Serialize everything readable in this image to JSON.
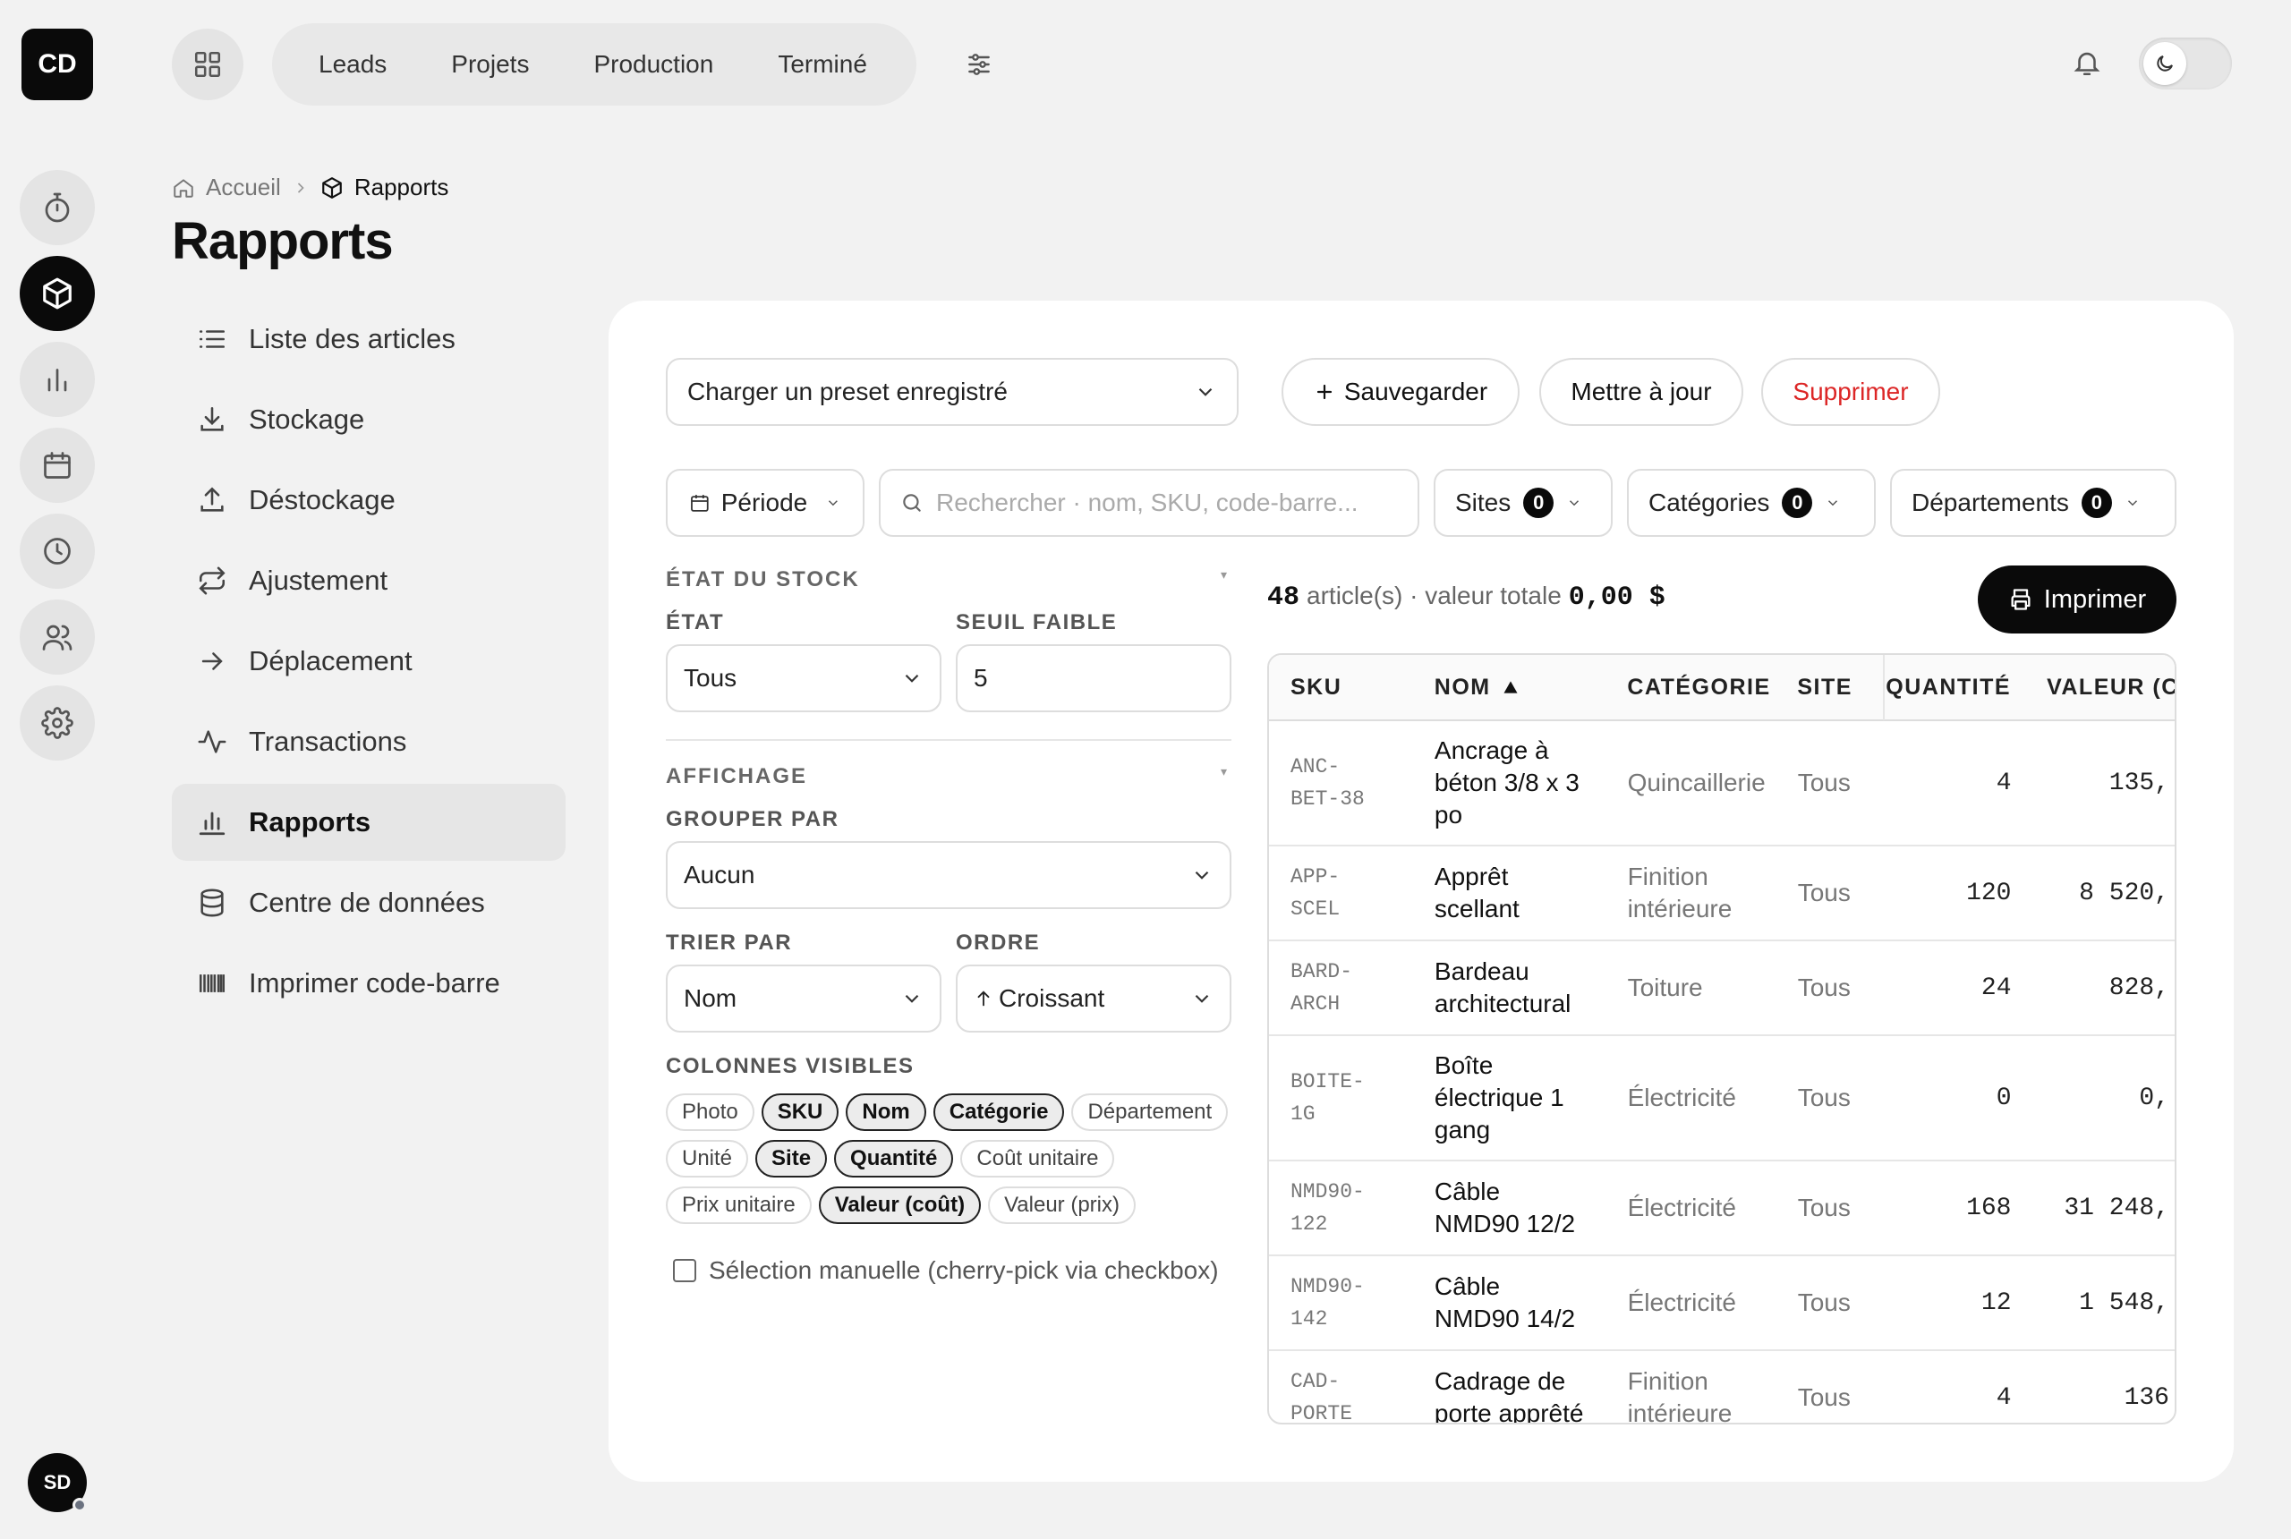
{
  "user": {
    "initials": "CD",
    "footer_initials": "SD"
  },
  "topnav": {
    "tabs": [
      "Leads",
      "Projets",
      "Production",
      "Terminé"
    ]
  },
  "breadcrumb": {
    "home": "Accueil",
    "current": "Rapports"
  },
  "page": {
    "title": "Rapports"
  },
  "sidebar": {
    "items": [
      {
        "label": "Liste des articles",
        "icon": "list-icon"
      },
      {
        "label": "Stockage",
        "icon": "download-icon"
      },
      {
        "label": "Déstockage",
        "icon": "upload-icon"
      },
      {
        "label": "Ajustement",
        "icon": "repeat-icon"
      },
      {
        "label": "Déplacement",
        "icon": "arrow-right-icon"
      },
      {
        "label": "Transactions",
        "icon": "activity-icon"
      },
      {
        "label": "Rapports",
        "icon": "bar-chart-icon",
        "active": true
      },
      {
        "label": "Centre de données",
        "icon": "database-icon"
      },
      {
        "label": "Imprimer code-barre",
        "icon": "barcode-icon"
      }
    ]
  },
  "toolbar": {
    "preset_placeholder": "Charger un preset enregistré",
    "save": "Sauvegarder",
    "update": "Mettre à jour",
    "delete": "Supprimer",
    "delete_color": "#dc2626"
  },
  "filters": {
    "period": "Période",
    "search_placeholder": "Rechercher · nom, SKU, code-barre...",
    "sites": {
      "label": "Sites",
      "count": "0"
    },
    "categories": {
      "label": "Catégories",
      "count": "0"
    },
    "departments": {
      "label": "Départements",
      "count": "0"
    }
  },
  "stock_state": {
    "section": "ÉTAT DU STOCK",
    "state_label": "ÉTAT",
    "state_value": "Tous",
    "threshold_label": "SEUIL FAIBLE",
    "threshold_value": "5"
  },
  "display": {
    "section": "AFFICHAGE",
    "group_label": "GROUPER PAR",
    "group_value": "Aucun",
    "sort_label": "TRIER PAR",
    "sort_value": "Nom",
    "order_label": "ORDRE",
    "order_value": "Croissant",
    "columns_label": "COLONNES VISIBLES",
    "columns": [
      {
        "label": "Photo",
        "on": false
      },
      {
        "label": "SKU",
        "on": true
      },
      {
        "label": "Nom",
        "on": true
      },
      {
        "label": "Catégorie",
        "on": true
      },
      {
        "label": "Département",
        "on": false
      },
      {
        "label": "Unité",
        "on": false
      },
      {
        "label": "Site",
        "on": true
      },
      {
        "label": "Quantité",
        "on": true
      },
      {
        "label": "Coût unitaire",
        "on": false
      },
      {
        "label": "Prix unitaire",
        "on": false
      },
      {
        "label": "Valeur (coût)",
        "on": true
      },
      {
        "label": "Valeur (prix)",
        "on": false
      }
    ],
    "manual_selection": "Sélection manuelle (cherry-pick via checkbox)"
  },
  "summary": {
    "count": "48",
    "count_suffix": "article(s) · valeur totale",
    "total": "0,00 $",
    "print": "Imprimer"
  },
  "table": {
    "headers": {
      "sku": "SKU",
      "name": "NOM",
      "category": "CATÉGORIE",
      "site": "SITE",
      "quantity": "QUANTITÉ",
      "value": "VALEUR (C"
    },
    "rows": [
      {
        "sku1": "ANC-",
        "sku2": "BET-38",
        "name": [
          "Ancrage à",
          "béton 3/8 x 3",
          "po"
        ],
        "category": [
          "Quincaillerie"
        ],
        "site": "Tous",
        "qty": "4",
        "value": "135,"
      },
      {
        "sku1": "APP-",
        "sku2": "SCEL",
        "name": [
          "Apprêt",
          "scellant"
        ],
        "category": [
          "Finition",
          "intérieure"
        ],
        "site": "Tous",
        "qty": "120",
        "value": "8 520,"
      },
      {
        "sku1": "BARD-",
        "sku2": "ARCH",
        "name": [
          "Bardeau",
          "architectural"
        ],
        "category": [
          "Toiture"
        ],
        "site": "Tous",
        "qty": "24",
        "value": "828,"
      },
      {
        "sku1": "BOITE-",
        "sku2": "1G",
        "name": [
          "Boîte",
          "électrique 1",
          "gang"
        ],
        "category": [
          "Électricité"
        ],
        "site": "Tous",
        "qty": "0",
        "value": "0,"
      },
      {
        "sku1": "NMD90-",
        "sku2": "122",
        "name": [
          "Câble",
          "NMD90 12/2"
        ],
        "category": [
          "Électricité"
        ],
        "site": "Tous",
        "qty": "168",
        "value": "31 248,"
      },
      {
        "sku1": "NMD90-",
        "sku2": "142",
        "name": [
          "Câble",
          "NMD90 14/2"
        ],
        "category": [
          "Électricité"
        ],
        "site": "Tous",
        "qty": "12",
        "value": "1 548,"
      },
      {
        "sku1": "CAD-",
        "sku2": "PORTE",
        "name": [
          "Cadrage de",
          "porte apprêté"
        ],
        "category": [
          "Finition",
          "intérieure"
        ],
        "site": "Tous",
        "qty": "4",
        "value": "136"
      }
    ]
  }
}
